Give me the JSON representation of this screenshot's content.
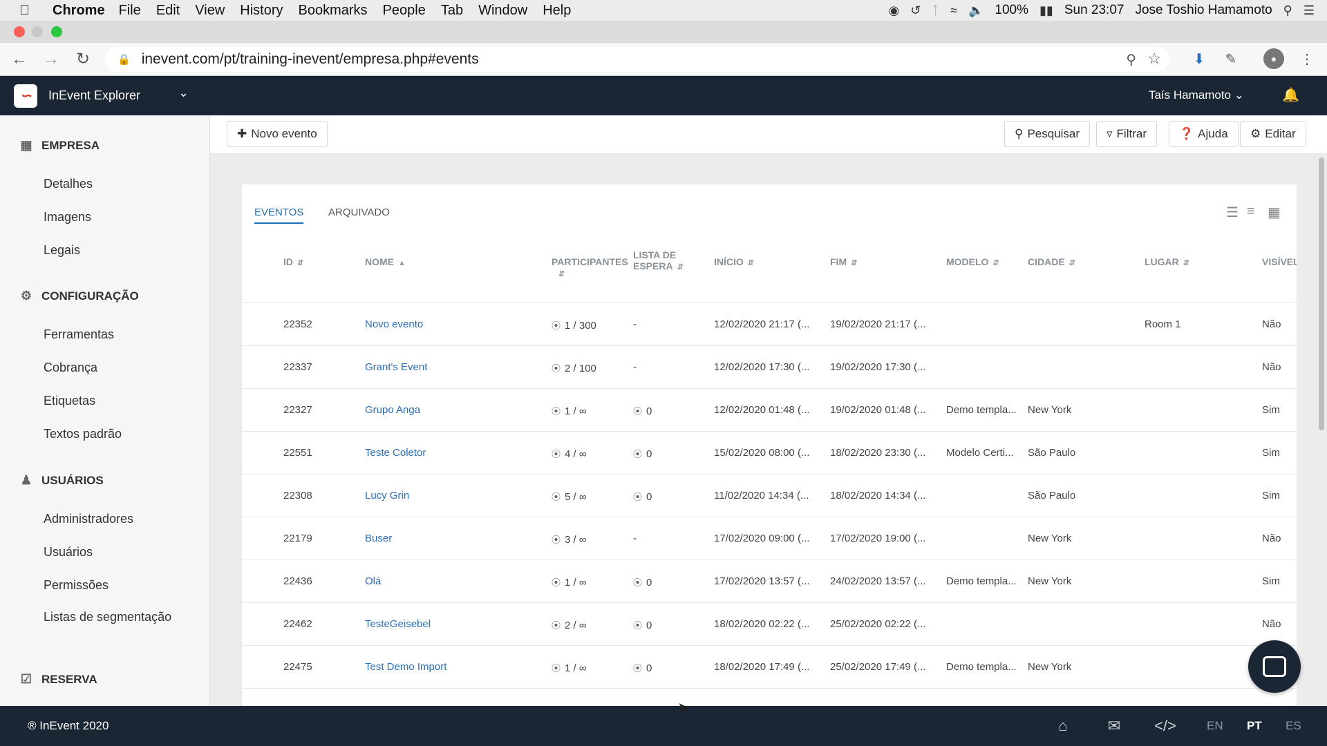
{
  "os_menu": {
    "app": "Chrome",
    "items": [
      "File",
      "Edit",
      "View",
      "History",
      "Bookmarks",
      "People",
      "Tab",
      "Window",
      "Help"
    ],
    "battery": "100%",
    "clock": "Sun 23:07",
    "user": "Jose Toshio Hamamoto"
  },
  "browser": {
    "url": "inevent.com/pt/training-inevent/empresa.php#events"
  },
  "header": {
    "app_name": "InEvent Explorer",
    "user": "Taís Hamamoto"
  },
  "sidebar": {
    "sections": [
      {
        "title": "EMPRESA",
        "icon": "building-icon",
        "items": [
          "Detalhes",
          "Imagens",
          "Legais"
        ]
      },
      {
        "title": "CONFIGURAÇÃO",
        "icon": "gear-icon",
        "items": [
          "Ferramentas",
          "Cobrança",
          "Etiquetas",
          "Textos padrão"
        ]
      },
      {
        "title": "USUÁRIOS",
        "icon": "users-icon",
        "items": [
          "Administradores",
          "Usuários",
          "Permissões",
          "Listas de segmentação"
        ]
      },
      {
        "title": "RESERVA",
        "icon": "calendar-check-icon",
        "items": []
      }
    ]
  },
  "toolbar": {
    "new_event": "Novo evento",
    "search": "Pesquisar",
    "filter": "Filtrar",
    "help": "Ajuda",
    "edit": "Editar"
  },
  "tabs": {
    "events": "EVENTOS",
    "archived": "ARQUIVADO"
  },
  "table": {
    "headers": {
      "id": "ID",
      "name": "NOME",
      "participants": "PARTICIPANTES",
      "waitlist_1": "LISTA DE",
      "waitlist_2": "ESPERA",
      "start": "INÍCIO",
      "end": "FIM",
      "model": "MODELO",
      "city": "CIDADE",
      "place": "LUGAR",
      "visible": "VISÍVEL"
    },
    "rows": [
      {
        "id": "22352",
        "name": "Novo evento",
        "participants": "1 / 300",
        "waitlist": "-",
        "start": "12/02/2020 21:17 (...",
        "end": "19/02/2020 21:17 (...",
        "model": "",
        "city": "",
        "place": "Room 1",
        "visible": "Não"
      },
      {
        "id": "22337",
        "name": "Grant's Event",
        "participants": "2 / 100",
        "waitlist": "-",
        "start": "12/02/2020 17:30 (...",
        "end": "19/02/2020 17:30 (...",
        "model": "",
        "city": "",
        "place": "",
        "visible": "Não"
      },
      {
        "id": "22327",
        "name": "Grupo Anga",
        "participants": "1 / ∞",
        "waitlist": "0",
        "start": "12/02/2020 01:48 (...",
        "end": "19/02/2020 01:48 (...",
        "model": "Demo templa...",
        "city": "New York",
        "place": "",
        "visible": "Sim"
      },
      {
        "id": "22551",
        "name": "Teste Coletor",
        "participants": "4 / ∞",
        "waitlist": "0",
        "start": "15/02/2020 08:00 (...",
        "end": "18/02/2020 23:30 (...",
        "model": "Modelo Certi...",
        "city": "São Paulo",
        "place": "",
        "visible": "Sim"
      },
      {
        "id": "22308",
        "name": "Lucy Grin",
        "participants": "5 / ∞",
        "waitlist": "0",
        "start": "11/02/2020 14:34 (...",
        "end": "18/02/2020 14:34 (...",
        "model": "",
        "city": "São Paulo",
        "place": "",
        "visible": "Sim"
      },
      {
        "id": "22179",
        "name": "Buser",
        "participants": "3 / ∞",
        "waitlist": "-",
        "start": "17/02/2020 09:00 (...",
        "end": "17/02/2020 19:00 (...",
        "model": "",
        "city": "New York",
        "place": "",
        "visible": "Não"
      },
      {
        "id": "22436",
        "name": "Olá",
        "participants": "1 / ∞",
        "waitlist": "0",
        "start": "17/02/2020 13:57 (...",
        "end": "24/02/2020 13:57 (...",
        "model": "Demo templa...",
        "city": "New York",
        "place": "",
        "visible": "Sim"
      },
      {
        "id": "22462",
        "name": "TesteGeisebel",
        "participants": "2 / ∞",
        "waitlist": "0",
        "start": "18/02/2020 02:22 (...",
        "end": "25/02/2020 02:22 (...",
        "model": "",
        "city": "",
        "place": "",
        "visible": "Não"
      },
      {
        "id": "22475",
        "name": "Test Demo Import",
        "participants": "1 / ∞",
        "waitlist": "0",
        "start": "18/02/2020 17:49 (...",
        "end": "25/02/2020 17:49 (...",
        "model": "Demo templa...",
        "city": "New York",
        "place": "",
        "visible": ""
      }
    ]
  },
  "footer": {
    "copyright": "® InEvent 2020",
    "langs": [
      "EN",
      "PT",
      "ES"
    ],
    "active_lang": "PT"
  },
  "colors": {
    "header_bg": "#1a2633",
    "link": "#2a6ebd",
    "tab_active": "#1f6fb8"
  }
}
